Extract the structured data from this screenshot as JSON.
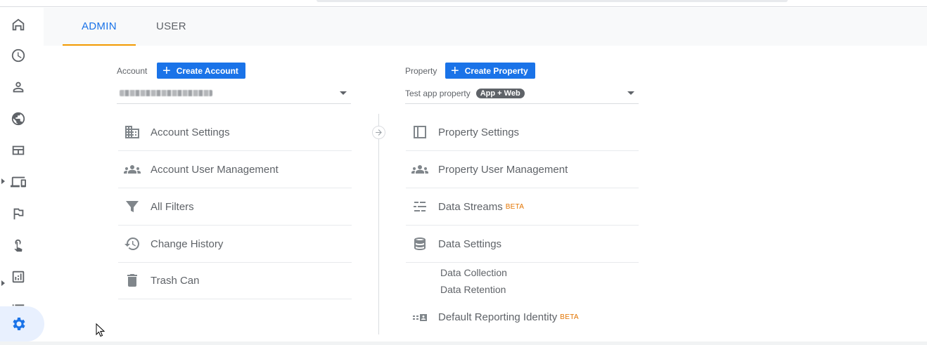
{
  "tabs": {
    "admin": "ADMIN",
    "user": "USER"
  },
  "account": {
    "label": "Account",
    "create_button": "Create Account",
    "selected": "",
    "menu": [
      {
        "label": "Account Settings"
      },
      {
        "label": "Account User Management"
      },
      {
        "label": "All Filters"
      },
      {
        "label": "Change History"
      },
      {
        "label": "Trash Can"
      }
    ]
  },
  "property": {
    "label": "Property",
    "create_button": "Create Property",
    "selected": "Test app property",
    "badge": "App + Web",
    "menu": [
      {
        "label": "Property Settings"
      },
      {
        "label": "Property User Management"
      },
      {
        "label": "Data Streams",
        "beta": "BETA"
      },
      {
        "label": "Data Settings"
      }
    ],
    "data_settings_sub": [
      "Data Collection",
      "Data Retention"
    ],
    "identity": {
      "label": "Default Reporting Identity",
      "beta": "BETA"
    }
  },
  "sidebar_icons": [
    "home-icon",
    "clock-icon",
    "person-icon",
    "globe-icon",
    "dashboard-icon",
    "devices-icon",
    "flag-icon",
    "touch-icon",
    "analytics-icon",
    "list-icon",
    "settings-icon"
  ],
  "colors": {
    "accent": "#1a73e8",
    "tab_underline": "#f29900",
    "beta": "#e37400"
  }
}
